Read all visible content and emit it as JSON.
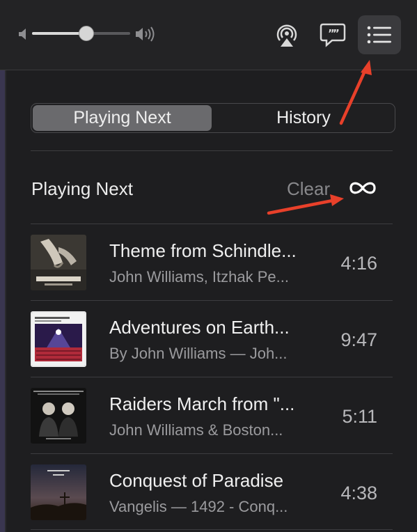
{
  "player": {
    "volume_fraction": 0.55
  },
  "toolbar": {
    "icons": [
      "volume-low-icon",
      "volume-high-icon",
      "airplay-icon",
      "lyrics-icon",
      "queue-list-icon"
    ]
  },
  "tabs": {
    "playing_next": "Playing Next",
    "history": "History",
    "active": "playing_next"
  },
  "queue": {
    "title": "Playing Next",
    "clear_label": "Clear",
    "autoplay_icon": "infinity-icon",
    "items": [
      {
        "title": "Theme from Schindle...",
        "artist": "John Williams, Itzhak Pe...",
        "duration": "4:16",
        "artwork": "schindlers-list-album-art"
      },
      {
        "title": "Adventures on Earth...",
        "artist": "By John Williams — Joh...",
        "duration": "9:47",
        "artwork": "john-williams-cinema-album-art"
      },
      {
        "title": "Raiders March from \"...",
        "artist": "John Williams & Boston...",
        "duration": "5:11",
        "artwork": "williams-mutter-album-art"
      },
      {
        "title": "Conquest of Paradise",
        "artist": "Vangelis — 1492 - Conq...",
        "duration": "4:38",
        "artwork": "vangelis-1492-album-art"
      }
    ]
  },
  "colors": {
    "background": "#1e1e20",
    "annotation_arrow": "#e8402a"
  }
}
